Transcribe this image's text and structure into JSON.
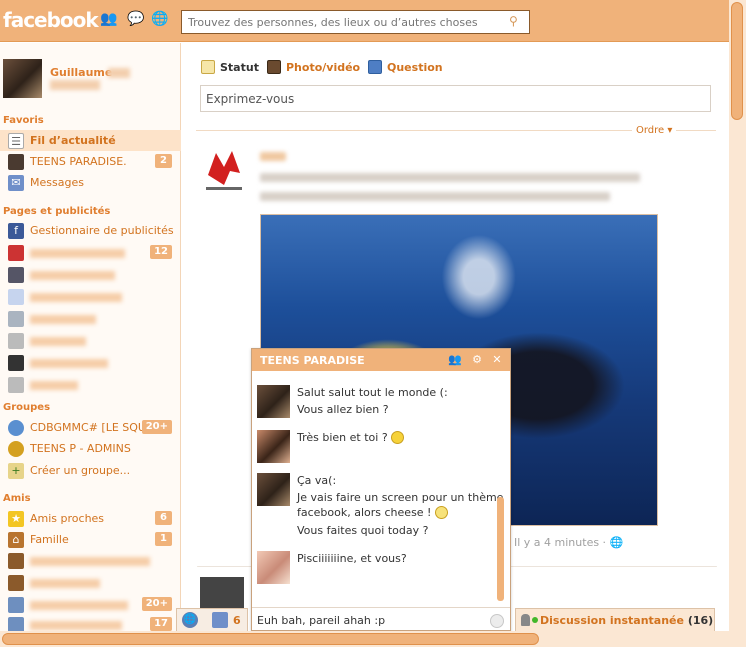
{
  "topbar": {
    "logo": "facebook",
    "search_placeholder": "Trouvez des personnes, des lieux ou d’autres choses"
  },
  "profile": {
    "name": "Guillaume"
  },
  "sidebar": {
    "favoris_title": "Favoris",
    "favoris": [
      {
        "label": "Fil d’actualité",
        "badge": ""
      },
      {
        "label": "TEENS PARADISE.",
        "badge": "2"
      },
      {
        "label": "Messages",
        "badge": ""
      }
    ],
    "pages_title": "Pages et publicités",
    "pages": [
      {
        "label": "Gestionnaire de publicités",
        "badge": ""
      },
      {
        "label": "",
        "badge": "12"
      }
    ],
    "groupes_title": "Groupes",
    "groupes": [
      {
        "label": "CDBGMMC# [LE SQU...",
        "badge": "20+"
      },
      {
        "label": "TEENS P - ADMINS",
        "badge": ""
      },
      {
        "label": "Créer un groupe...",
        "badge": ""
      }
    ],
    "amis_title": "Amis",
    "amis": [
      {
        "label": "Amis proches",
        "badge": "6"
      },
      {
        "label": "Famille",
        "badge": "1"
      }
    ],
    "amis_extra_badges": [
      "20+",
      "17"
    ]
  },
  "composer": {
    "tabs": [
      "Statut",
      "Photo/vidéo",
      "Question"
    ],
    "placeholder": "Exprimez-vous"
  },
  "feed": {
    "order_label": "Ordre",
    "post_meta": "Il y a 4 minutes"
  },
  "chat": {
    "title": "TEENS PARADISE",
    "messages": [
      [
        "Salut salut tout le monde (:",
        "Vous allez bien ?"
      ],
      [
        "Très bien et toi ?"
      ],
      [
        "Ça va(:",
        "Je vais faire un screen pour un thème",
        "facebook, alors cheese !",
        "Vous faites quoi today ?"
      ],
      [
        "Pisciiiiiiine, et vous?"
      ]
    ],
    "input_value": "Euh bah, pareil ahah :p"
  },
  "dock": {
    "count": "6",
    "chat_label": "Discussion instantanée",
    "online_count": "(16)"
  },
  "colors": {
    "accent": "#f0b27a",
    "link": "#d2731f"
  }
}
